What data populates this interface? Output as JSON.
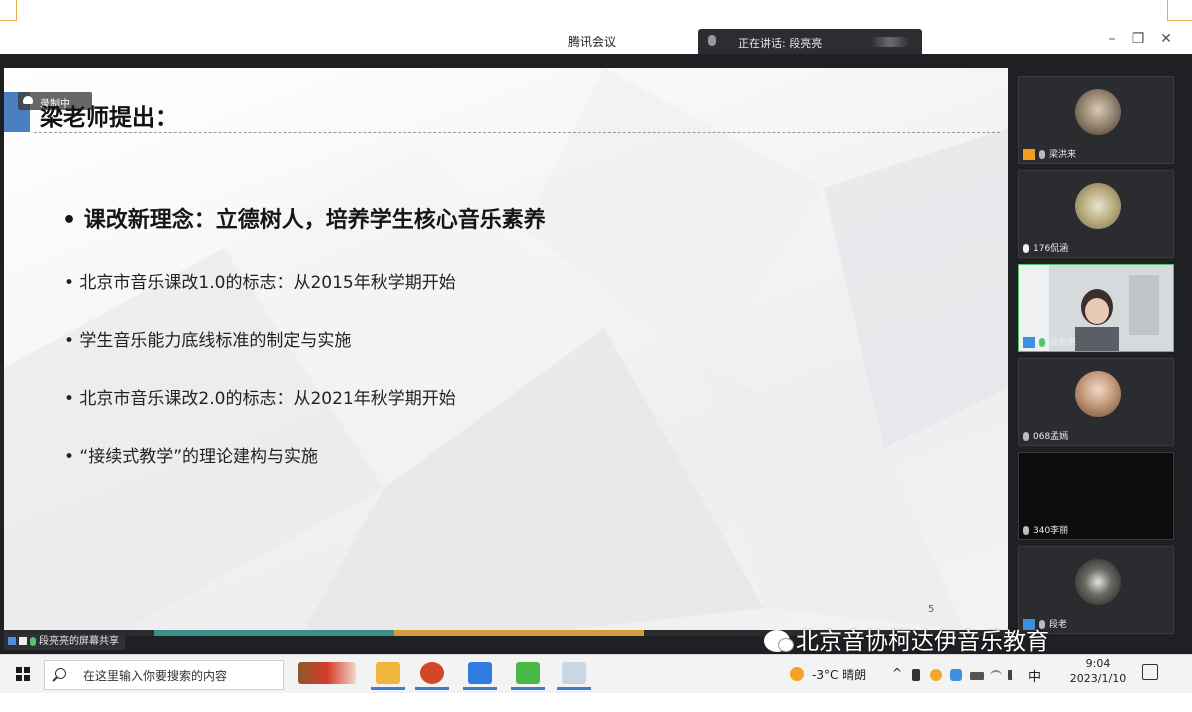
{
  "window": {
    "title": "腾讯会议",
    "speaking_label": "正在讲话: 段亮亮",
    "controls": {
      "minimize": "–",
      "restore": "❐",
      "close": "✕"
    }
  },
  "recording": {
    "label": "录制中"
  },
  "slide": {
    "heading": "梁老师提出：",
    "main_bullet": "• 课改新理念：立德树人，培养学生核心音乐素养",
    "bullets": [
      "• 北京市音乐课改1.0的标志：从2015年秋学期开始",
      "• 学生音乐能力底线标准的制定与实施",
      "• 北京市音乐课改2.0的标志：从2021年秋学期开始",
      "•  “接续式教学”的理论建构与实施"
    ],
    "page_number": "5"
  },
  "share": {
    "label": "段亮亮的屏幕共享"
  },
  "participants": [
    {
      "name": "梁洪来",
      "role": "host"
    },
    {
      "name": "176侃涵",
      "role": "member"
    },
    {
      "name": "段亮亮",
      "role": "speaker"
    },
    {
      "name": "068孟嫣",
      "role": "member"
    },
    {
      "name": "340李丽",
      "role": "member"
    },
    {
      "name": "段老",
      "role": "member"
    }
  ],
  "watermark": {
    "text": "北京音协柯达伊音乐教育"
  },
  "taskbar": {
    "search_placeholder": "在这里输入你要搜索的内容",
    "weather": "-3°C 晴朗",
    "ime": "中",
    "time": "9:04",
    "date": "2023/1/10"
  },
  "colors": {
    "accent_blue": "#4a7fc1",
    "speaker_border": "#56c06a",
    "host_badge": "#f0a020",
    "progress_teal": "#3b8f8a",
    "progress_orange": "#d89b3a"
  }
}
